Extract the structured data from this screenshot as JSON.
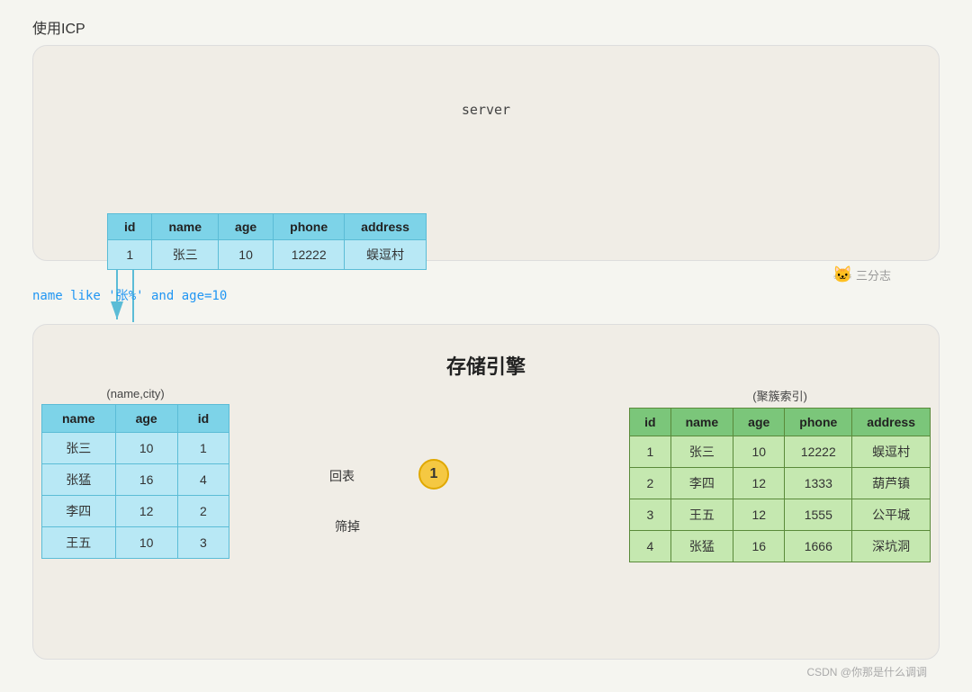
{
  "title": "使用ICP",
  "server_label": "server",
  "storage_label": "存储引擎",
  "query_text": "name like '张%' and age=10",
  "top_table": {
    "headers": [
      "id",
      "name",
      "age",
      "phone",
      "address"
    ],
    "rows": [
      [
        "1",
        "张三",
        "10",
        "12222",
        "蜈逗村"
      ]
    ]
  },
  "left_table": {
    "label": "(name,city)",
    "headers": [
      "name",
      "age",
      "id"
    ],
    "rows": [
      {
        "name": "张三",
        "age": "10",
        "id": "1",
        "highlight": true
      },
      {
        "name": "张猛",
        "age": "16",
        "id": "4",
        "highlight": true
      },
      {
        "name": "李四",
        "age": "12",
        "id": "2",
        "highlight": false
      },
      {
        "name": "王五",
        "age": "10",
        "id": "3",
        "highlight": false
      }
    ]
  },
  "right_table": {
    "label": "(聚簇索引)",
    "headers": [
      "id",
      "name",
      "age",
      "phone",
      "address"
    ],
    "rows": [
      {
        "id": "1",
        "name": "张三",
        "age": "10",
        "phone": "12222",
        "address": "蜈逗村",
        "highlight": true
      },
      {
        "id": "2",
        "name": "李四",
        "age": "12",
        "phone": "1333",
        "address": "葫芦镇"
      },
      {
        "id": "3",
        "name": "王五",
        "age": "12",
        "phone": "1555",
        "address": "公平城"
      },
      {
        "id": "4",
        "name": "张猛",
        "age": "16",
        "phone": "1666",
        "address": "深坑洞"
      }
    ]
  },
  "huibiao_label": "回表",
  "shaidi_label": "筛掉",
  "circle_value": "1",
  "watermark": "CSDN @你那是什么调调",
  "sanfenzhi": "三分志"
}
